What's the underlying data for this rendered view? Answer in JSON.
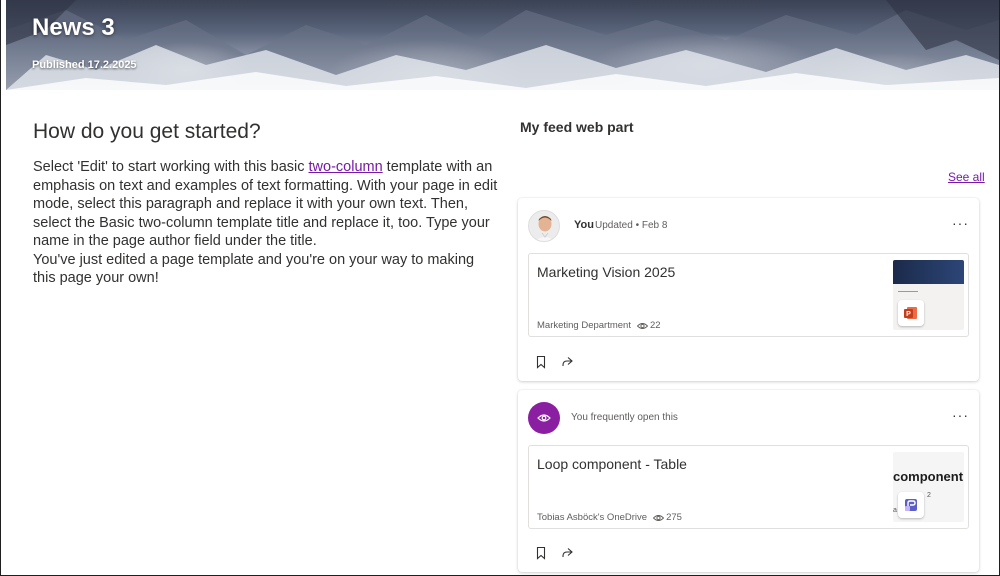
{
  "hero": {
    "title": "News 3",
    "published": "Published 17.2.2025"
  },
  "article": {
    "heading": "How do you get started?",
    "para1_before_link": "Select 'Edit' to start working with this basic ",
    "para1_link": "two-column",
    "para1_after_link": " template with an emphasis on text and examples of text formatting. With your page in edit mode, select this paragraph and replace it with your own text. Then, select the Basic two-column template title and replace it, too. Type your name in the page author field under the title.",
    "para2": "You've just edited a page template and you're on your way to making this page your own!"
  },
  "feed": {
    "title": "My feed web part",
    "see_all": "See all",
    "cards": [
      {
        "author": "You",
        "meta": "Updated • Feb 8",
        "doc_title": "Marketing Vision 2025",
        "source": "Marketing Department",
        "views": "22",
        "file_type_icon": "powerpoint-icon"
      },
      {
        "author": "",
        "meta": "You frequently open this",
        "doc_title": "Loop component - Table",
        "source": "Tobias Asböck's OneDrive",
        "views": "275",
        "thumb_text": "component -",
        "thumb_digit": "2",
        "thumb_fragment": "a",
        "file_type_icon": "loop-icon"
      }
    ],
    "more_label": "···"
  },
  "colors": {
    "accent": "#7719aa",
    "avatar_purple": "#8b1fa2",
    "powerpoint": "#c43e1c"
  }
}
